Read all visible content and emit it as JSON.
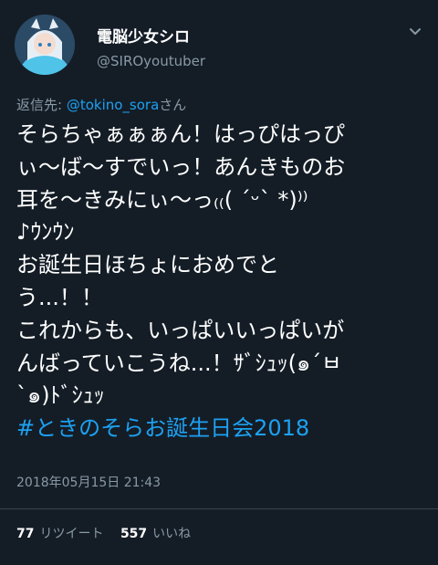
{
  "user": {
    "display_name": "電脳少女シロ",
    "handle": "@SIROyoutuber"
  },
  "reply": {
    "prefix": "返信先: ",
    "mention": "@tokino_sora",
    "suffix": "さん"
  },
  "tweet": {
    "lines": [
      "そらちゃぁぁぁん！はっぴはっぴ",
      "ぃ〜ば〜すでいっ！あんきものお",
      "耳を〜きみにぃ〜っ₍₍( ´ᵕ` *)⁾⁾",
      "♪ｳﾝｳﾝ",
      "お誕生日ほちょにおめでと",
      "う...！！",
      "これからも、いっぱいいっぱいが",
      "んばっていこうね...！ｻﾞｼｭｯ(๑´ㅂ",
      "`๑)ﾄﾞｼｭｯ"
    ],
    "hashtag": "#ときのそらお誕生日会2018",
    "timestamp": "2018年05月15日 21:43"
  },
  "stats": {
    "retweets_count": "77",
    "retweets_label": "リツイート",
    "likes_count": "557",
    "likes_label": "いいね"
  },
  "colors": {
    "background": "#141d26",
    "link": "#1da1f2",
    "secondary_text": "#8899a6"
  }
}
